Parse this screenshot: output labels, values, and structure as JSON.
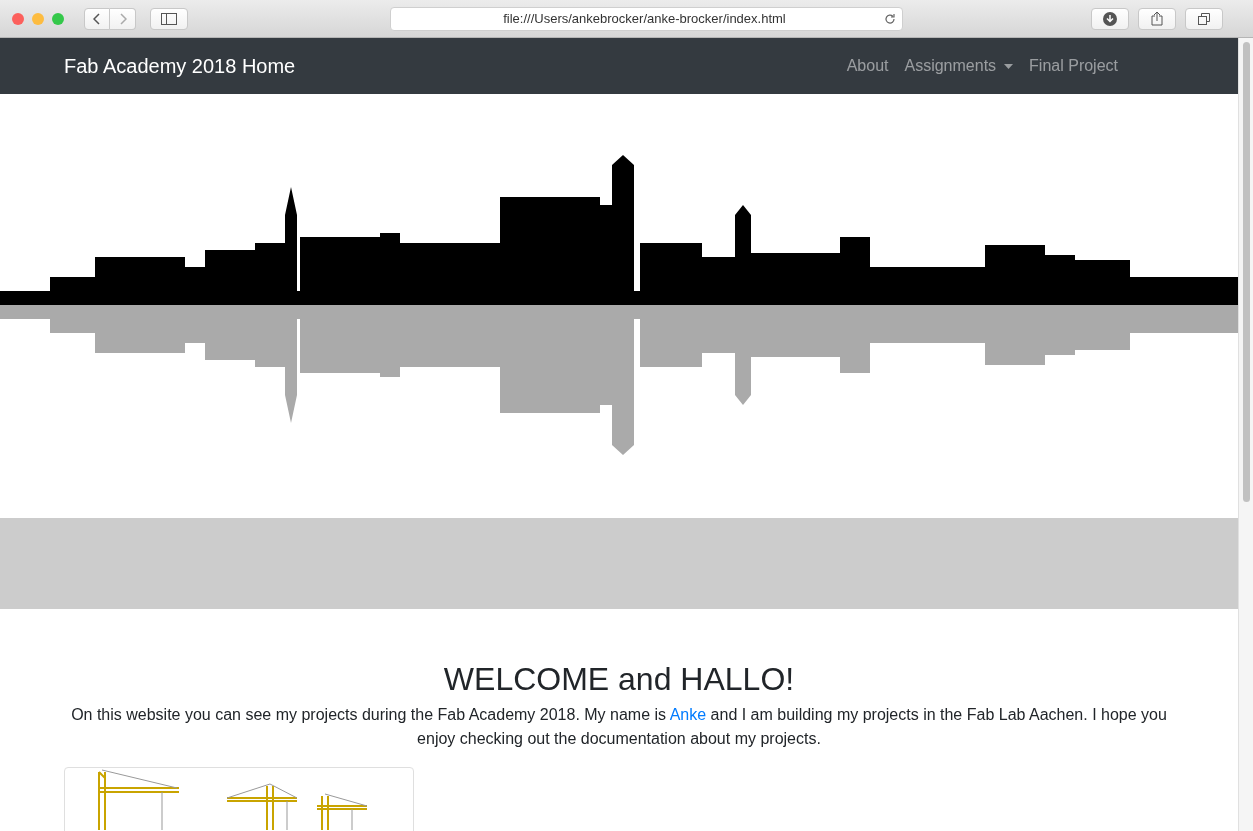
{
  "browser": {
    "url": "file:///Users/ankebrocker/anke-brocker/index.html"
  },
  "navbar": {
    "brand": "Fab Academy 2018 Home",
    "links": [
      {
        "label": "About",
        "kind": "link"
      },
      {
        "label": "Assignments",
        "kind": "dropdown"
      },
      {
        "label": "Final Project",
        "kind": "link"
      }
    ]
  },
  "welcome": {
    "heading": "WELCOME and HALLO!",
    "intro": {
      "before": "On this website you can see my projects during the Fab Academy 2018. My name is",
      "link": "Anke",
      "after": "and I am building my projects in the Fab Lab Aachen. I hope you enjoy checking out the documentation about my projects."
    }
  }
}
